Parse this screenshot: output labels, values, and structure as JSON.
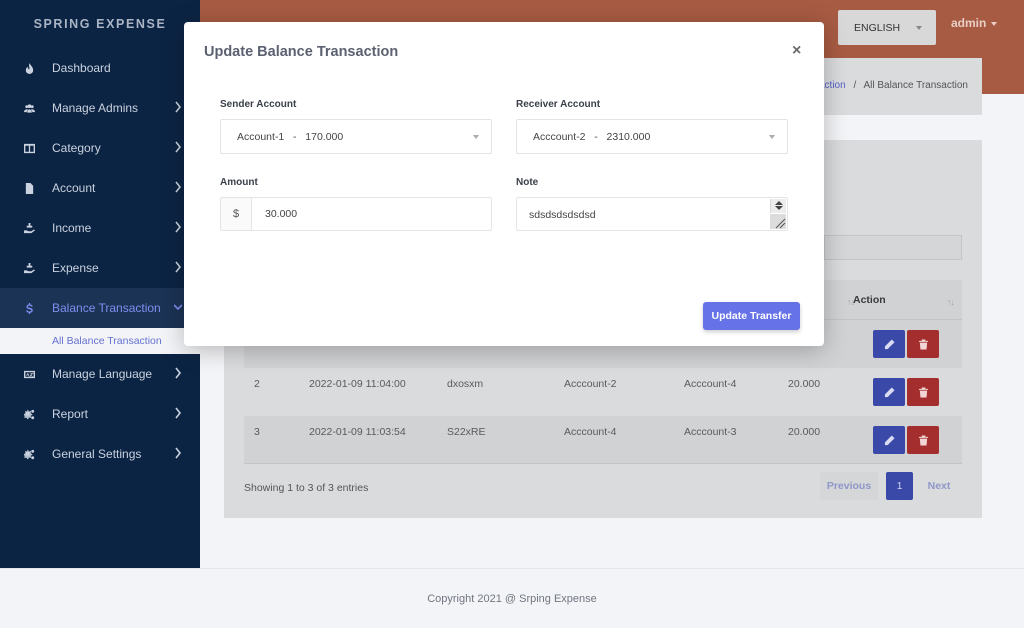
{
  "brand": "SPRING EXPENSE",
  "sidebar": {
    "items": [
      {
        "label": "Dashboard",
        "icon": "fire-icon"
      },
      {
        "label": "Manage Admins",
        "icon": "users-icon"
      },
      {
        "label": "Category",
        "icon": "columns-icon"
      },
      {
        "label": "Account",
        "icon": "file-icon"
      },
      {
        "label": "Income",
        "icon": "hand-holding-icon"
      },
      {
        "label": "Expense",
        "icon": "hand-holding-icon"
      },
      {
        "label": "Balance Transaction",
        "icon": "dollar-icon"
      },
      {
        "label": "Manage Language",
        "icon": "language-icon"
      },
      {
        "label": "Report",
        "icon": "cogs-icon"
      },
      {
        "label": "General Settings",
        "icon": "cogs-icon"
      }
    ],
    "active_sub": "All Balance Transaction"
  },
  "topbar": {
    "language": "ENGLISH",
    "user": "admin"
  },
  "breadcrumb": {
    "link": "action",
    "separator": "/",
    "current": "All Balance Transaction"
  },
  "table": {
    "action_header": "Action",
    "rows": [
      {
        "id": "2",
        "date": "2022-01-09 11:04:00",
        "ref": "dxosxm",
        "from": "Acccount-2",
        "to": "Acccount-4",
        "amount": "20.000"
      },
      {
        "id": "3",
        "date": "2022-01-09 11:03:54",
        "ref": "S22xRE",
        "from": "Acccount-4",
        "to": "Acccount-3",
        "amount": "20.000"
      }
    ],
    "entries_info": "Showing 1 to 3 of 3 entries",
    "pagination": {
      "prev": "Previous",
      "page": "1",
      "next": "Next"
    }
  },
  "footer": {
    "text": "Copyright 2021 @ Srping Expense"
  },
  "modal": {
    "title": "Update Balance Transaction",
    "close": "×",
    "sender_label": "Sender Account",
    "sender_value": "Account-1   -   170.000",
    "receiver_label": "Receiver Account",
    "receiver_value": "Acccount-2   -   2310.000",
    "amount_label": "Amount",
    "currency": "$",
    "amount_value": "30.000",
    "note_label": "Note",
    "note_value": "sdsdsdsdsdsd",
    "submit": "Update Transfer"
  },
  "colors": {
    "sidebar_bg": "#0c2444",
    "topbar_bg": "#a85b43",
    "accent": "#6672e8",
    "edit_button": "#3a48a8",
    "delete_button": "#a42e2e"
  }
}
